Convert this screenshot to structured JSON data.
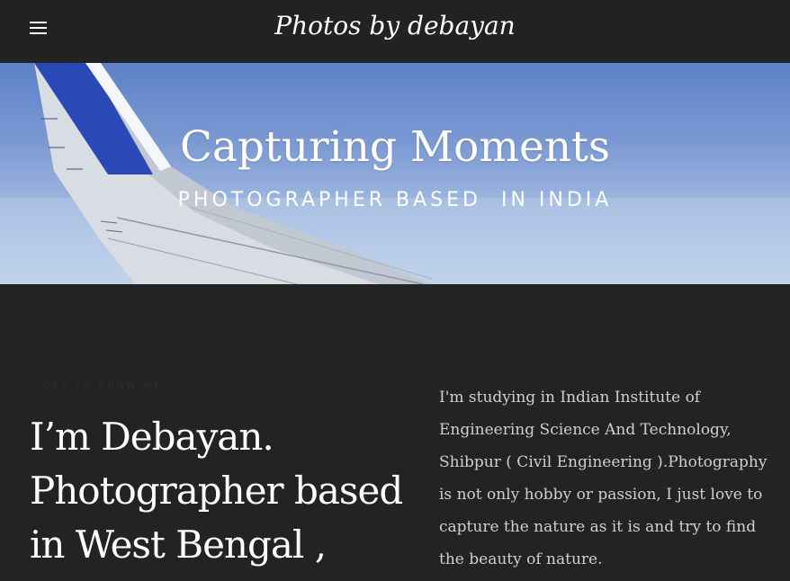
{
  "header": {
    "menu_icon": "hamburger-menu-icon",
    "site_title": "Photos by debayan"
  },
  "hero": {
    "title": "Capturing Moments",
    "subtitle": "PHOTOGRAPHER BASED  IN INDIA"
  },
  "about": {
    "eyebrow": "GET TO KNOW ME",
    "heading": "I’m Debayan. Photographer based in West Bengal ,",
    "description": "I'm studying in Indian Institute of Engineering Science And Technology, Shibpur ( Civil Engineering ).Photography is not only hobby or passion, I just love to capture the nature as it is and try to find the beauty of nature."
  },
  "colors": {
    "background": "#232323",
    "header": "#222222",
    "sky": "#7a98d2",
    "heading_text": "#ffffff",
    "body_text": "#cfcfcf"
  }
}
